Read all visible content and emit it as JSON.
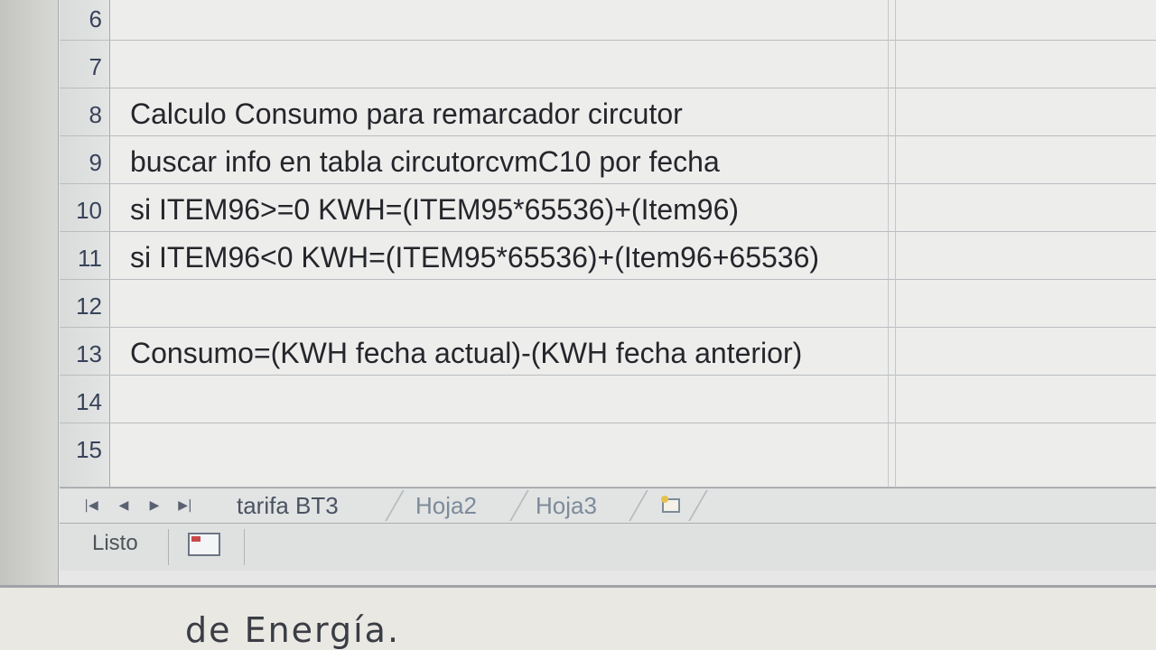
{
  "rows": [
    {
      "num": "6",
      "text": ""
    },
    {
      "num": "7",
      "text": ""
    },
    {
      "num": "8",
      "text": "Calculo Consumo para remarcador circutor"
    },
    {
      "num": "9",
      "text": "buscar info en tabla circutorcvmC10 por fecha"
    },
    {
      "num": "10",
      "text": "si ITEM96>=0  KWH=(ITEM95*65536)+(Item96)"
    },
    {
      "num": "11",
      "text": "si ITEM96<0   KWH=(ITEM95*65536)+(Item96+65536)"
    },
    {
      "num": "12",
      "text": ""
    },
    {
      "num": "13",
      "text": "Consumo=(KWH fecha actual)-(KWH fecha anterior)"
    },
    {
      "num": "14",
      "text": ""
    },
    {
      "num": "15",
      "text": ""
    }
  ],
  "tabs": {
    "nav": [
      "|◀",
      "◀",
      "▶",
      "▶|"
    ],
    "sheets": [
      "tarifa BT3",
      "Hoja2",
      "Hoja3"
    ],
    "active_color": "#4b5361",
    "inactive_color": "#7d8b9a"
  },
  "status": {
    "label": "Listo"
  },
  "background": {
    "text": "de Energía."
  }
}
